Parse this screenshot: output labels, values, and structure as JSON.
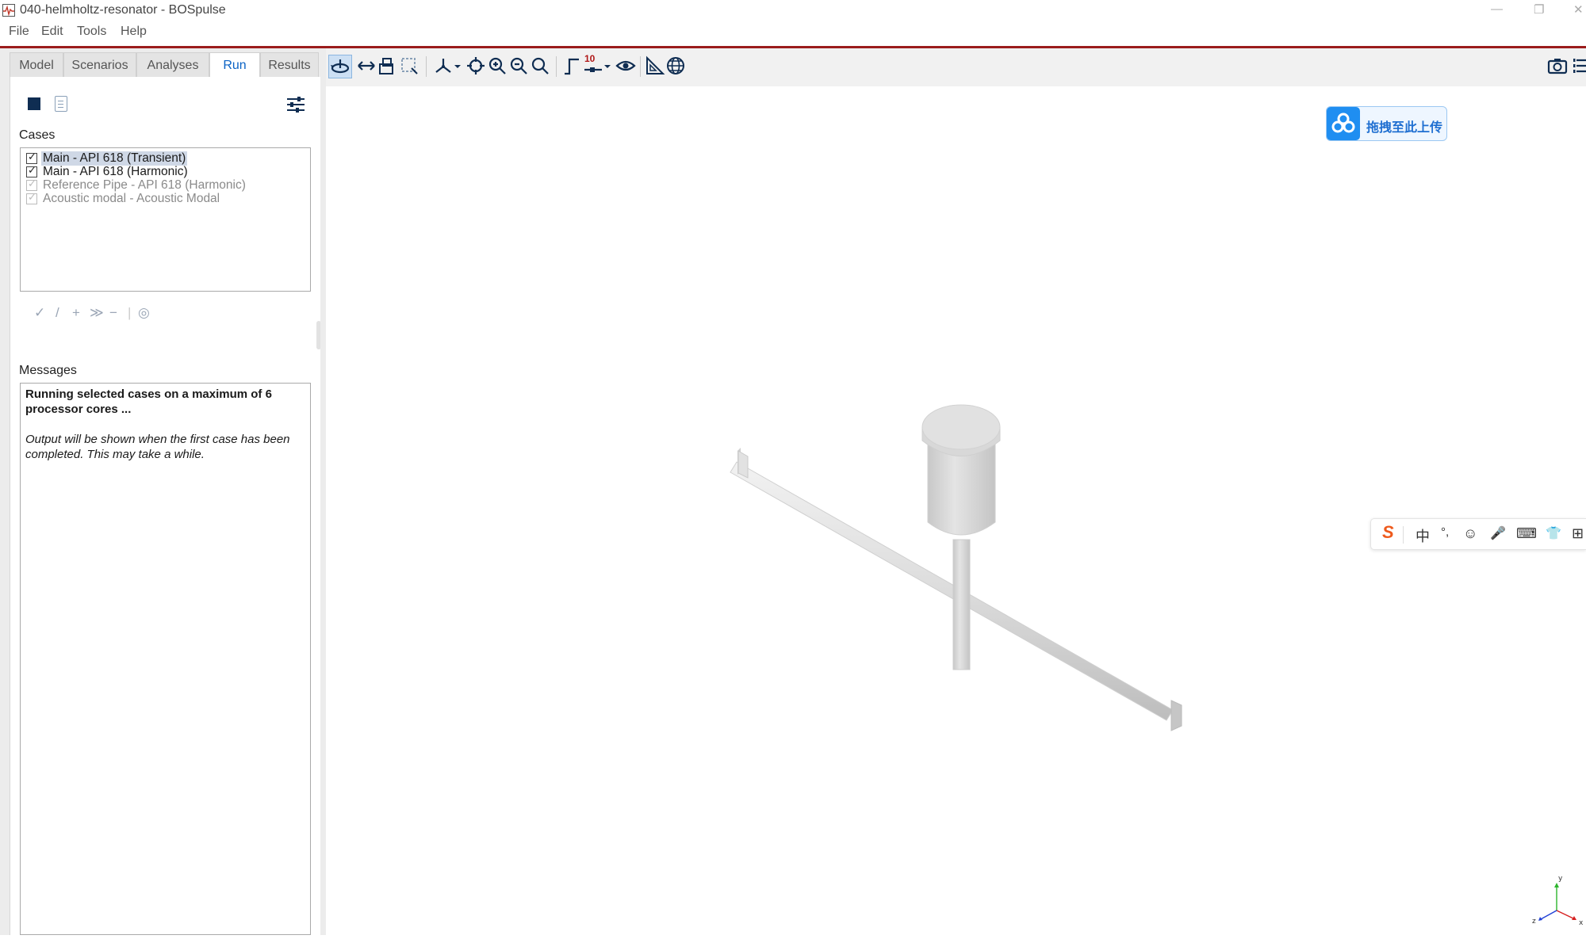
{
  "window": {
    "title": "040-helmholtz-resonator - BOSpulse",
    "minimize": "—",
    "restore": "❐",
    "close": "✕"
  },
  "menu": {
    "items": [
      "File",
      "Edit",
      "Tools",
      "Help"
    ]
  },
  "tabs": [
    {
      "label": "Model",
      "active": false
    },
    {
      "label": "Scenarios",
      "active": false
    },
    {
      "label": "Analyses",
      "active": false
    },
    {
      "label": "Run",
      "active": true
    },
    {
      "label": "Results",
      "active": false
    }
  ],
  "cases": {
    "label": "Cases",
    "items": [
      {
        "label": "Main - API 618 (Transient)",
        "checked": true,
        "selected": true,
        "enabled": true
      },
      {
        "label": "Main - API 618 (Harmonic)",
        "checked": true,
        "selected": false,
        "enabled": true
      },
      {
        "label": "Reference Pipe - API 618 (Harmonic)",
        "checked": true,
        "selected": false,
        "enabled": false
      },
      {
        "label": "Acoustic modal - Acoustic Modal",
        "checked": true,
        "selected": false,
        "enabled": false
      }
    ],
    "tools": [
      "✓",
      "/",
      "+",
      "≫",
      "−",
      "◎"
    ]
  },
  "messages": {
    "label": "Messages",
    "bold_text": "Running selected cases on a maximum of 6 processor cores ...",
    "italic_text": "Output will be shown when the first case has been completed. This may take a while."
  },
  "toolbar": {
    "grid_count_label": "10",
    "icons": [
      "rotate-view-icon",
      "pan-icon",
      "fit-view-icon",
      "select-box-icon",
      "axis-view-icon",
      "center-target-icon",
      "zoom-in-icon",
      "zoom-out-icon",
      "zoom-search-icon",
      "snap-corner-icon",
      "grid-count-icon",
      "visibility-eye-icon",
      "measure-icon",
      "globe-icon",
      "camera-icon"
    ]
  },
  "upload": {
    "label": "拖拽至此上传"
  },
  "ime": {
    "items": [
      "S",
      "中",
      "°,",
      "☺",
      "🎤",
      "⌨",
      "👕",
      "⊞"
    ]
  },
  "axes": {
    "x": "x",
    "y": "y",
    "z": "z"
  },
  "colors": {
    "accent": "#0b63c5",
    "menu_rule": "#9b1c1c",
    "stop_button": "#0f2d52",
    "upload_blue": "#1f8ef1",
    "ime_logo": "#ee5a1c"
  }
}
